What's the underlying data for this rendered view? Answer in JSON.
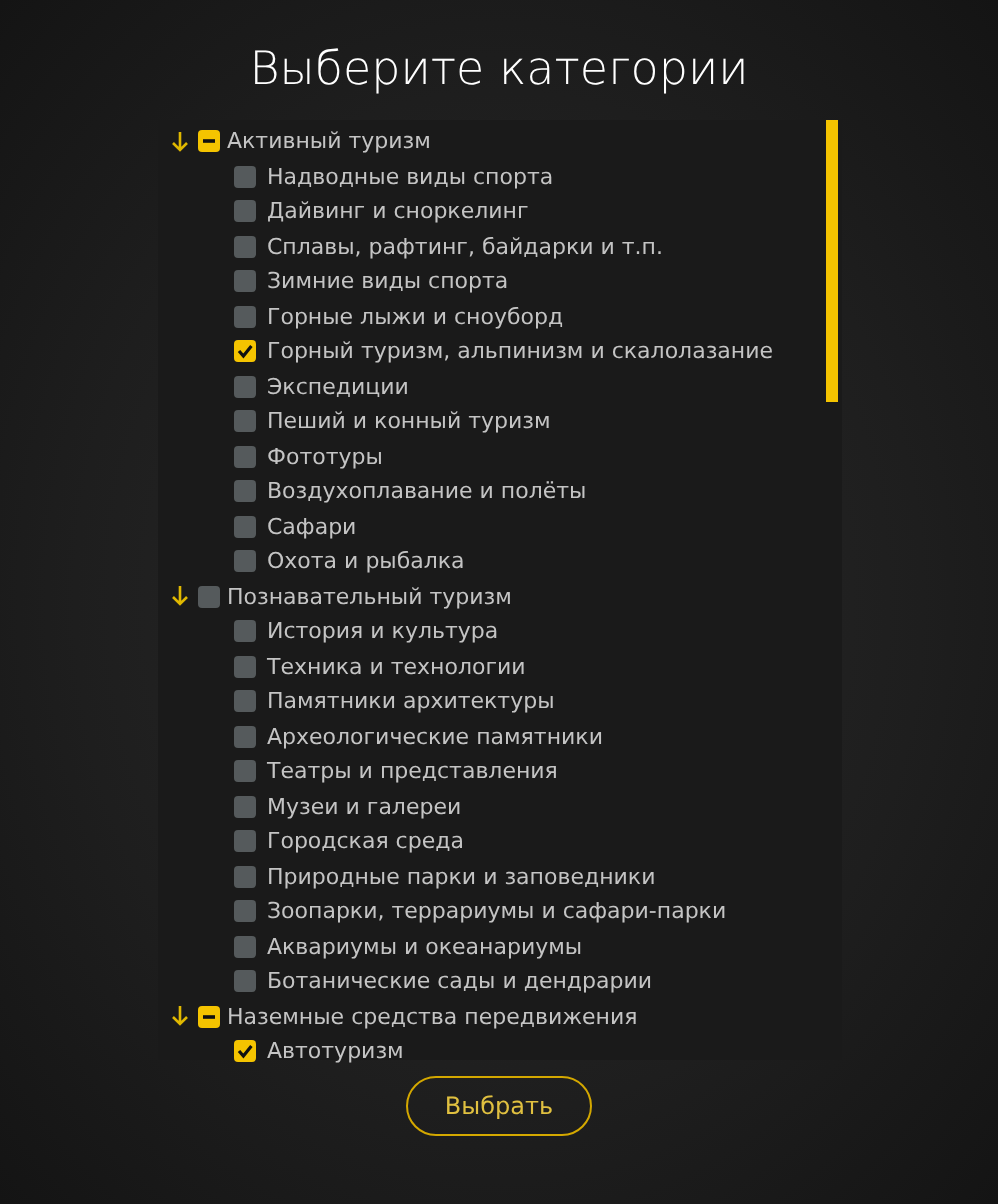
{
  "title": "Выберите категории",
  "groups": [
    {
      "label": "Активный туризм",
      "expanded": true,
      "checked": false,
      "indeterminate": true,
      "children": [
        {
          "label": "Надводные виды спорта",
          "checked": false
        },
        {
          "label": "Дайвинг и сноркелинг",
          "checked": false
        },
        {
          "label": "Сплавы, рафтинг, байдарки и т.п.",
          "checked": false
        },
        {
          "label": "Зимние виды спорта",
          "checked": false
        },
        {
          "label": "Горные лыжи и сноуборд",
          "checked": false
        },
        {
          "label": "Горный туризм, альпинизм и скалолазание",
          "checked": true
        },
        {
          "label": "Экспедиции",
          "checked": false
        },
        {
          "label": "Пеший и конный туризм",
          "checked": false
        },
        {
          "label": "Фототуры",
          "checked": false
        },
        {
          "label": "Воздухоплавание и полёты",
          "checked": false
        },
        {
          "label": "Сафари",
          "checked": false
        },
        {
          "label": "Охота и рыбалка",
          "checked": false
        }
      ]
    },
    {
      "label": "Познавательный туризм",
      "expanded": true,
      "checked": false,
      "indeterminate": false,
      "children": [
        {
          "label": "История и культура",
          "checked": false
        },
        {
          "label": "Техника и технологии",
          "checked": false
        },
        {
          "label": "Памятники архитектуры",
          "checked": false
        },
        {
          "label": "Археологические памятники",
          "checked": false
        },
        {
          "label": "Театры и представления",
          "checked": false
        },
        {
          "label": "Музеи и галереи",
          "checked": false
        },
        {
          "label": "Городская среда",
          "checked": false
        },
        {
          "label": "Природные парки и заповедники",
          "checked": false
        },
        {
          "label": "Зоопарки, террариумы и сафари-парки",
          "checked": false
        },
        {
          "label": "Аквариумы и океанариумы",
          "checked": false
        },
        {
          "label": "Ботанические сады и дендрарии",
          "checked": false
        }
      ]
    },
    {
      "label": "Наземные средства передвижения",
      "expanded": true,
      "checked": false,
      "indeterminate": true,
      "children": [
        {
          "label": "Автотуризм",
          "checked": true
        }
      ]
    }
  ],
  "button": "Выбрать"
}
